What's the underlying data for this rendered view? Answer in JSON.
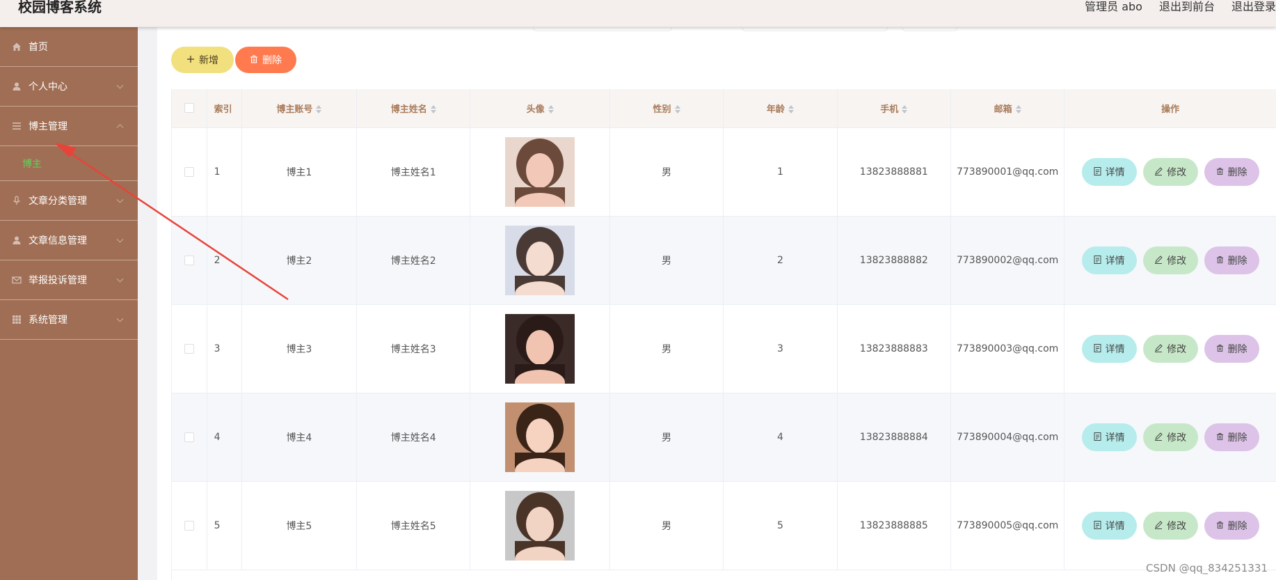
{
  "header": {
    "title": "校园博客系统",
    "user_label": "管理员 abo",
    "front_link": "退出到前台",
    "logout_link": "退出登录"
  },
  "sidebar": {
    "items": [
      {
        "label": "首页",
        "icon": "home-icon",
        "has_chevron": false
      },
      {
        "label": "个人中心",
        "icon": "user-icon",
        "has_chevron": true
      },
      {
        "label": "博主管理",
        "icon": "list-icon",
        "has_chevron": true,
        "expanded": true
      },
      {
        "label": "文章分类管理",
        "icon": "microphone-icon",
        "has_chevron": true
      },
      {
        "label": "文章信息管理",
        "icon": "user-icon",
        "has_chevron": true
      },
      {
        "label": "举报投诉管理",
        "icon": "mail-icon",
        "has_chevron": true
      },
      {
        "label": "系统管理",
        "icon": "grid-icon",
        "has_chevron": true
      }
    ],
    "submenu": {
      "label": "博主",
      "color": "#5fd35a"
    }
  },
  "toolbar": {
    "add_label": "新增",
    "delete_label": "删除"
  },
  "table": {
    "headers": {
      "index": "索引",
      "account": "博主账号",
      "name": "博主姓名",
      "avatar": "头像",
      "gender": "性别",
      "age": "年龄",
      "phone": "手机",
      "email": "邮箱",
      "actions": "操作"
    },
    "rows": [
      {
        "index": "1",
        "account": "博主1",
        "name": "博主姓名1",
        "gender": "男",
        "age": "1",
        "phone": "13823888881",
        "email": "773890001@qq.com"
      },
      {
        "index": "2",
        "account": "博主2",
        "name": "博主姓名2",
        "gender": "男",
        "age": "2",
        "phone": "13823888882",
        "email": "773890002@qq.com"
      },
      {
        "index": "3",
        "account": "博主3",
        "name": "博主姓名3",
        "gender": "男",
        "age": "3",
        "phone": "13823888883",
        "email": "773890003@qq.com"
      },
      {
        "index": "4",
        "account": "博主4",
        "name": "博主姓名4",
        "gender": "男",
        "age": "4",
        "phone": "13823888884",
        "email": "773890004@qq.com"
      },
      {
        "index": "5",
        "account": "博主5",
        "name": "博主姓名5",
        "gender": "男",
        "age": "5",
        "phone": "13823888885",
        "email": "773890005@qq.com"
      }
    ],
    "action_labels": {
      "detail": "详情",
      "edit": "修改",
      "delete": "删除"
    }
  },
  "watermark": "CSDN @qq_834251331",
  "colors": {
    "sidebar_bg": "#a06e54",
    "add_button": "#f2e07e",
    "delete_button": "#ff7b4f",
    "detail_button": "#b6ecec",
    "edit_button": "#c7e8c8",
    "row_delete_button": "#dcc3e7",
    "header_text": "#a87b5a",
    "annotation_arrow": "#e8433a"
  }
}
